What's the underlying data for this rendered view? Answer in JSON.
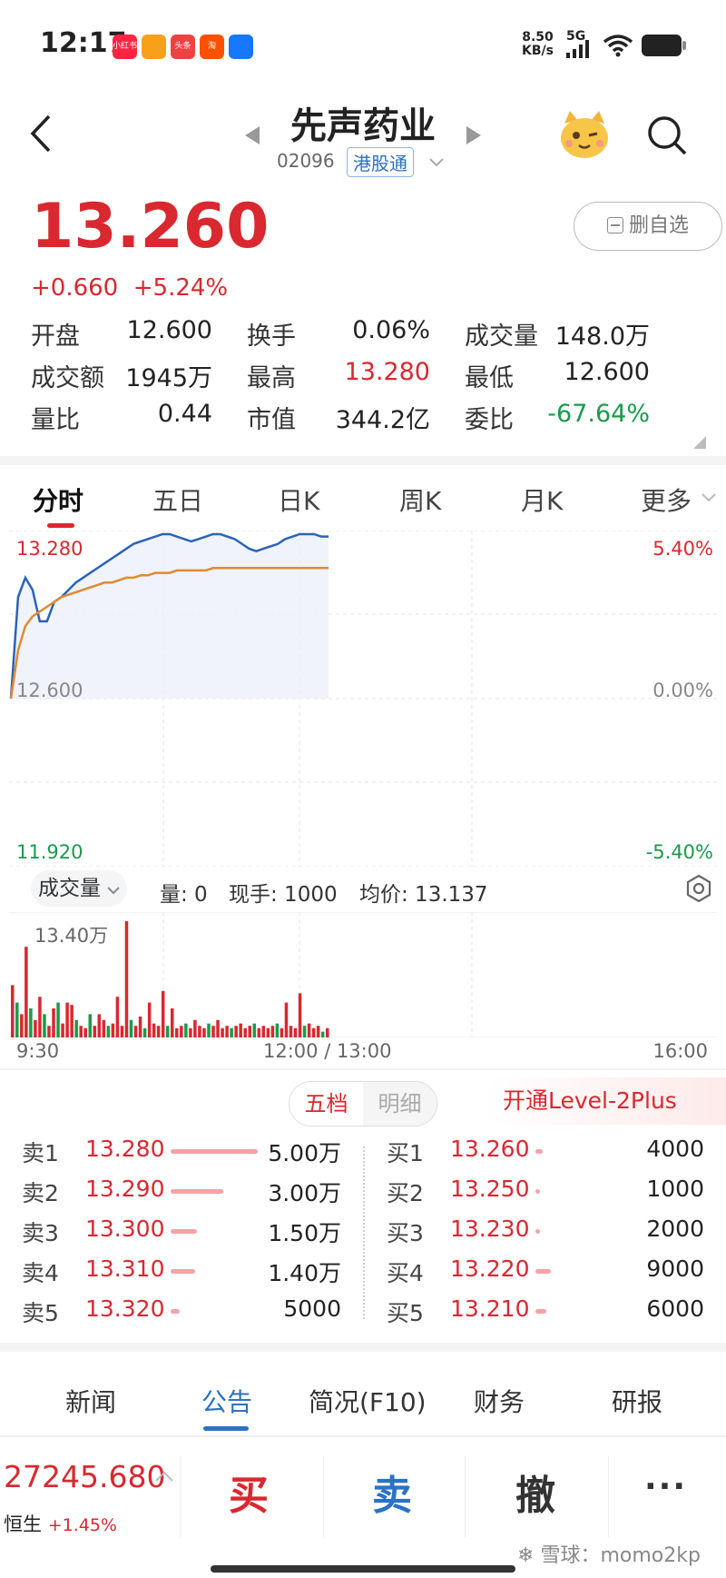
{
  "status": {
    "time": "12:17",
    "net_speed": "8.50",
    "net_unit": "KB/s",
    "signal": "5G",
    "apps": [
      {
        "name": "xiaohongshu-app-icon",
        "label": "小红书",
        "color": "#ff2442"
      },
      {
        "name": "weibo-app-icon",
        "label": "",
        "color": "#f7a11a"
      },
      {
        "name": "toutiao-app-icon",
        "label": "头条",
        "color": "#f04142"
      },
      {
        "name": "taobao-app-icon",
        "label": "淘",
        "color": "#ff5000"
      },
      {
        "name": "alipay-app-icon",
        "label": "",
        "color": "#1677ff"
      }
    ]
  },
  "header": {
    "title": "先声药业",
    "code": "02096",
    "tag": "港股通",
    "delete_watch": "删自选"
  },
  "quote": {
    "price": "13.260",
    "change": "+0.660",
    "change_pct": "+5.24%",
    "stats": [
      {
        "label": "开盘",
        "value": "12.600",
        "color": "#222"
      },
      {
        "label": "换手",
        "value": "0.06%",
        "color": "#222"
      },
      {
        "label": "成交量",
        "value": "148.0万",
        "color": "#222"
      },
      {
        "label": "成交额",
        "value": "1945万",
        "color": "#222"
      },
      {
        "label": "最高",
        "value": "13.280",
        "color": "#d9282f"
      },
      {
        "label": "最低",
        "value": "12.600",
        "color": "#222"
      },
      {
        "label": "量比",
        "value": "0.44",
        "color": "#222"
      },
      {
        "label": "市值",
        "value": "344.2亿",
        "color": "#222"
      },
      {
        "label": "委比",
        "value": "-67.64%",
        "color": "#1a9b4a"
      }
    ]
  },
  "chart_tabs": [
    "分时",
    "五日",
    "日K",
    "周K",
    "月K",
    "更多"
  ],
  "chart_tab_active": 0,
  "chart_data": {
    "type": "line",
    "y_left_labels": [
      "13.280",
      "12.600",
      "11.920"
    ],
    "y_right_labels": [
      "5.40%",
      "0.00%",
      "-5.40%"
    ],
    "ylim": [
      11.92,
      13.28
    ],
    "x_ticks": [
      "9:30",
      "12:00 / 13:00",
      "16:00"
    ],
    "series": [
      {
        "color": "#2a63b8",
        "values": [
          12.6,
          13.02,
          13.1,
          13.05,
          12.92,
          12.92,
          13.0,
          13.02,
          13.05,
          13.08,
          13.1,
          13.12,
          13.14,
          13.16,
          13.18,
          13.2,
          13.22,
          13.24,
          13.25,
          13.26,
          13.27,
          13.28,
          13.28,
          13.27,
          13.26,
          13.25,
          13.26,
          13.27,
          13.28,
          13.28,
          13.27,
          13.26,
          13.24,
          13.22,
          13.21,
          13.22,
          13.23,
          13.24,
          13.26,
          13.27,
          13.28,
          13.28,
          13.28,
          13.27,
          13.27
        ]
      },
      {
        "color": "#e08a2e",
        "values": [
          12.6,
          12.8,
          12.9,
          12.94,
          12.96,
          12.98,
          13.0,
          13.02,
          13.03,
          13.04,
          13.05,
          13.06,
          13.07,
          13.08,
          13.08,
          13.09,
          13.1,
          13.1,
          13.11,
          13.11,
          13.12,
          13.12,
          13.12,
          13.13,
          13.13,
          13.13,
          13.13,
          13.13,
          13.14,
          13.14,
          13.14,
          13.14,
          13.14,
          13.14,
          13.14,
          13.14,
          13.14,
          13.14,
          13.14,
          13.14,
          13.14,
          13.14,
          13.14,
          13.14,
          13.14
        ]
      }
    ],
    "volume": {
      "max_label": "13.40万",
      "bars": [
        [
          0.45,
          "r"
        ],
        [
          0.3,
          "g"
        ],
        [
          0.2,
          "r"
        ],
        [
          0.78,
          "r"
        ],
        [
          0.25,
          "g"
        ],
        [
          0.15,
          "r"
        ],
        [
          0.35,
          "r"
        ],
        [
          0.2,
          "g"
        ],
        [
          0.1,
          "r"
        ],
        [
          0.25,
          "r"
        ],
        [
          0.3,
          "g"
        ],
        [
          0.12,
          "r"
        ],
        [
          0.3,
          "r"
        ],
        [
          0.28,
          "r"
        ],
        [
          0.15,
          "g"
        ],
        [
          0.1,
          "r"
        ],
        [
          0.08,
          "r"
        ],
        [
          0.2,
          "g"
        ],
        [
          0.1,
          "r"
        ],
        [
          0.2,
          "r"
        ],
        [
          0.15,
          "r"
        ],
        [
          0.1,
          "g"
        ],
        [
          0.12,
          "r"
        ],
        [
          0.35,
          "r"
        ],
        [
          0.1,
          "r"
        ],
        [
          1.0,
          "r"
        ],
        [
          0.15,
          "g"
        ],
        [
          0.1,
          "r"
        ],
        [
          0.18,
          "r"
        ],
        [
          0.08,
          "g"
        ],
        [
          0.3,
          "r"
        ],
        [
          0.12,
          "r"
        ],
        [
          0.1,
          "r"
        ],
        [
          0.4,
          "r"
        ],
        [
          0.1,
          "g"
        ],
        [
          0.25,
          "r"
        ],
        [
          0.08,
          "r"
        ],
        [
          0.1,
          "r"
        ],
        [
          0.12,
          "g"
        ],
        [
          0.08,
          "r"
        ],
        [
          0.15,
          "r"
        ],
        [
          0.1,
          "r"
        ],
        [
          0.08,
          "r"
        ],
        [
          0.12,
          "g"
        ],
        [
          0.1,
          "r"
        ],
        [
          0.15,
          "r"
        ],
        [
          0.08,
          "r"
        ],
        [
          0.1,
          "r"
        ],
        [
          0.08,
          "g"
        ],
        [
          0.1,
          "r"
        ],
        [
          0.12,
          "r"
        ],
        [
          0.08,
          "r"
        ],
        [
          0.1,
          "r"
        ],
        [
          0.12,
          "g"
        ],
        [
          0.08,
          "r"
        ],
        [
          0.1,
          "r"
        ],
        [
          0.08,
          "r"
        ],
        [
          0.1,
          "r"
        ],
        [
          0.12,
          "g"
        ],
        [
          0.08,
          "r"
        ],
        [
          0.3,
          "r"
        ],
        [
          0.1,
          "r"
        ],
        [
          0.08,
          "r"
        ],
        [
          0.38,
          "r"
        ],
        [
          0.1,
          "g"
        ],
        [
          0.12,
          "r"
        ],
        [
          0.08,
          "r"
        ],
        [
          0.1,
          "r"
        ],
        [
          0.05,
          "g"
        ],
        [
          0.08,
          "r"
        ]
      ]
    }
  },
  "volume_info": {
    "selector": "成交量",
    "qty": "量: 0",
    "last": "现手: 1000",
    "avg": "均价: 13.137"
  },
  "orderbook": {
    "tabs": [
      "五档",
      "明细"
    ],
    "level2": "开通Level-2Plus",
    "asks": [
      {
        "label": "卖1",
        "price": "13.280",
        "vol": "5.00万",
        "ratio": 1.0
      },
      {
        "label": "卖2",
        "price": "13.290",
        "vol": "3.00万",
        "ratio": 0.6
      },
      {
        "label": "卖3",
        "price": "13.300",
        "vol": "1.50万",
        "ratio": 0.3
      },
      {
        "label": "卖4",
        "price": "13.310",
        "vol": "1.40万",
        "ratio": 0.28
      },
      {
        "label": "卖5",
        "price": "13.320",
        "vol": "5000",
        "ratio": 0.1
      }
    ],
    "bids": [
      {
        "label": "买1",
        "price": "13.260",
        "vol": "4000",
        "ratio": 0.08
      },
      {
        "label": "买2",
        "price": "13.250",
        "vol": "1000",
        "ratio": 0.02
      },
      {
        "label": "买3",
        "price": "13.230",
        "vol": "2000",
        "ratio": 0.04
      },
      {
        "label": "买4",
        "price": "13.220",
        "vol": "9000",
        "ratio": 0.18
      },
      {
        "label": "买5",
        "price": "13.210",
        "vol": "6000",
        "ratio": 0.12
      }
    ]
  },
  "bottom_tabs": [
    "新闻",
    "公告",
    "简况(F10)",
    "财务",
    "研报"
  ],
  "bottom_tab_active": 1,
  "index_bar": {
    "value": "27245.680",
    "name": "恒生",
    "pct": "+1.45%"
  },
  "actions": {
    "buy": "买",
    "sell": "卖",
    "cancel": "撤",
    "more": "···"
  },
  "watermark": "雪球：momo2kp"
}
